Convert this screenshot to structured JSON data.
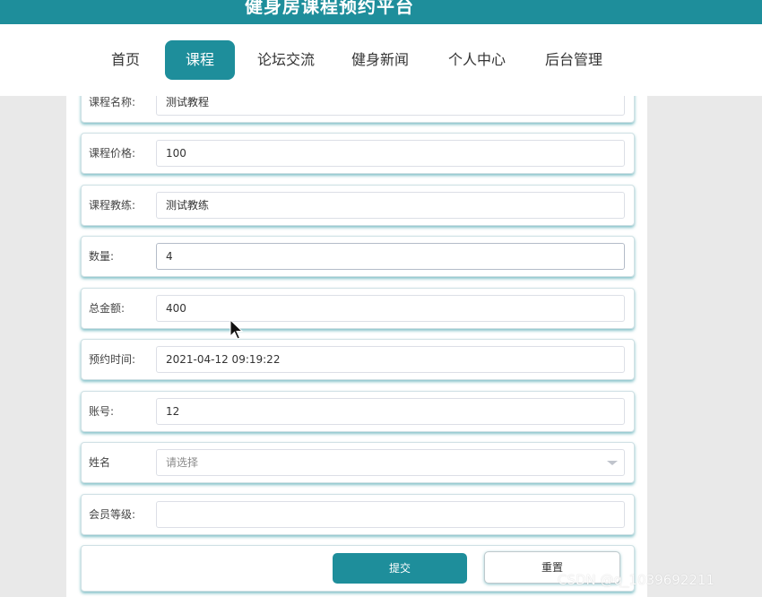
{
  "header": {
    "title": "健身房课程预约平台"
  },
  "nav": [
    {
      "label": "首页"
    },
    {
      "label": "课程"
    },
    {
      "label": "论坛交流"
    },
    {
      "label": "健身新闻"
    },
    {
      "label": "个人中心"
    },
    {
      "label": "后台管理"
    }
  ],
  "form": {
    "course_name": {
      "label": "课程名称:",
      "value": "测试教程"
    },
    "course_price": {
      "label": "课程价格:",
      "value": "100"
    },
    "coach": {
      "label": "课程教练:",
      "value": "测试教练"
    },
    "quantity": {
      "label": "数量:",
      "value": "4"
    },
    "total": {
      "label": "总金额:",
      "value": "400"
    },
    "booking_time": {
      "label": "预约时间:",
      "value": "2021-04-12 09:19:22"
    },
    "account": {
      "label": "账号:",
      "value": "12"
    },
    "name": {
      "label": "姓名",
      "placeholder": "请选择"
    },
    "member_level": {
      "label": "会员等级:",
      "value": ""
    }
  },
  "actions": {
    "submit": "提交",
    "reset": "重置"
  },
  "watermark": "CSDN @q_1039692211",
  "colors": {
    "accent": "#1e8e9b"
  }
}
